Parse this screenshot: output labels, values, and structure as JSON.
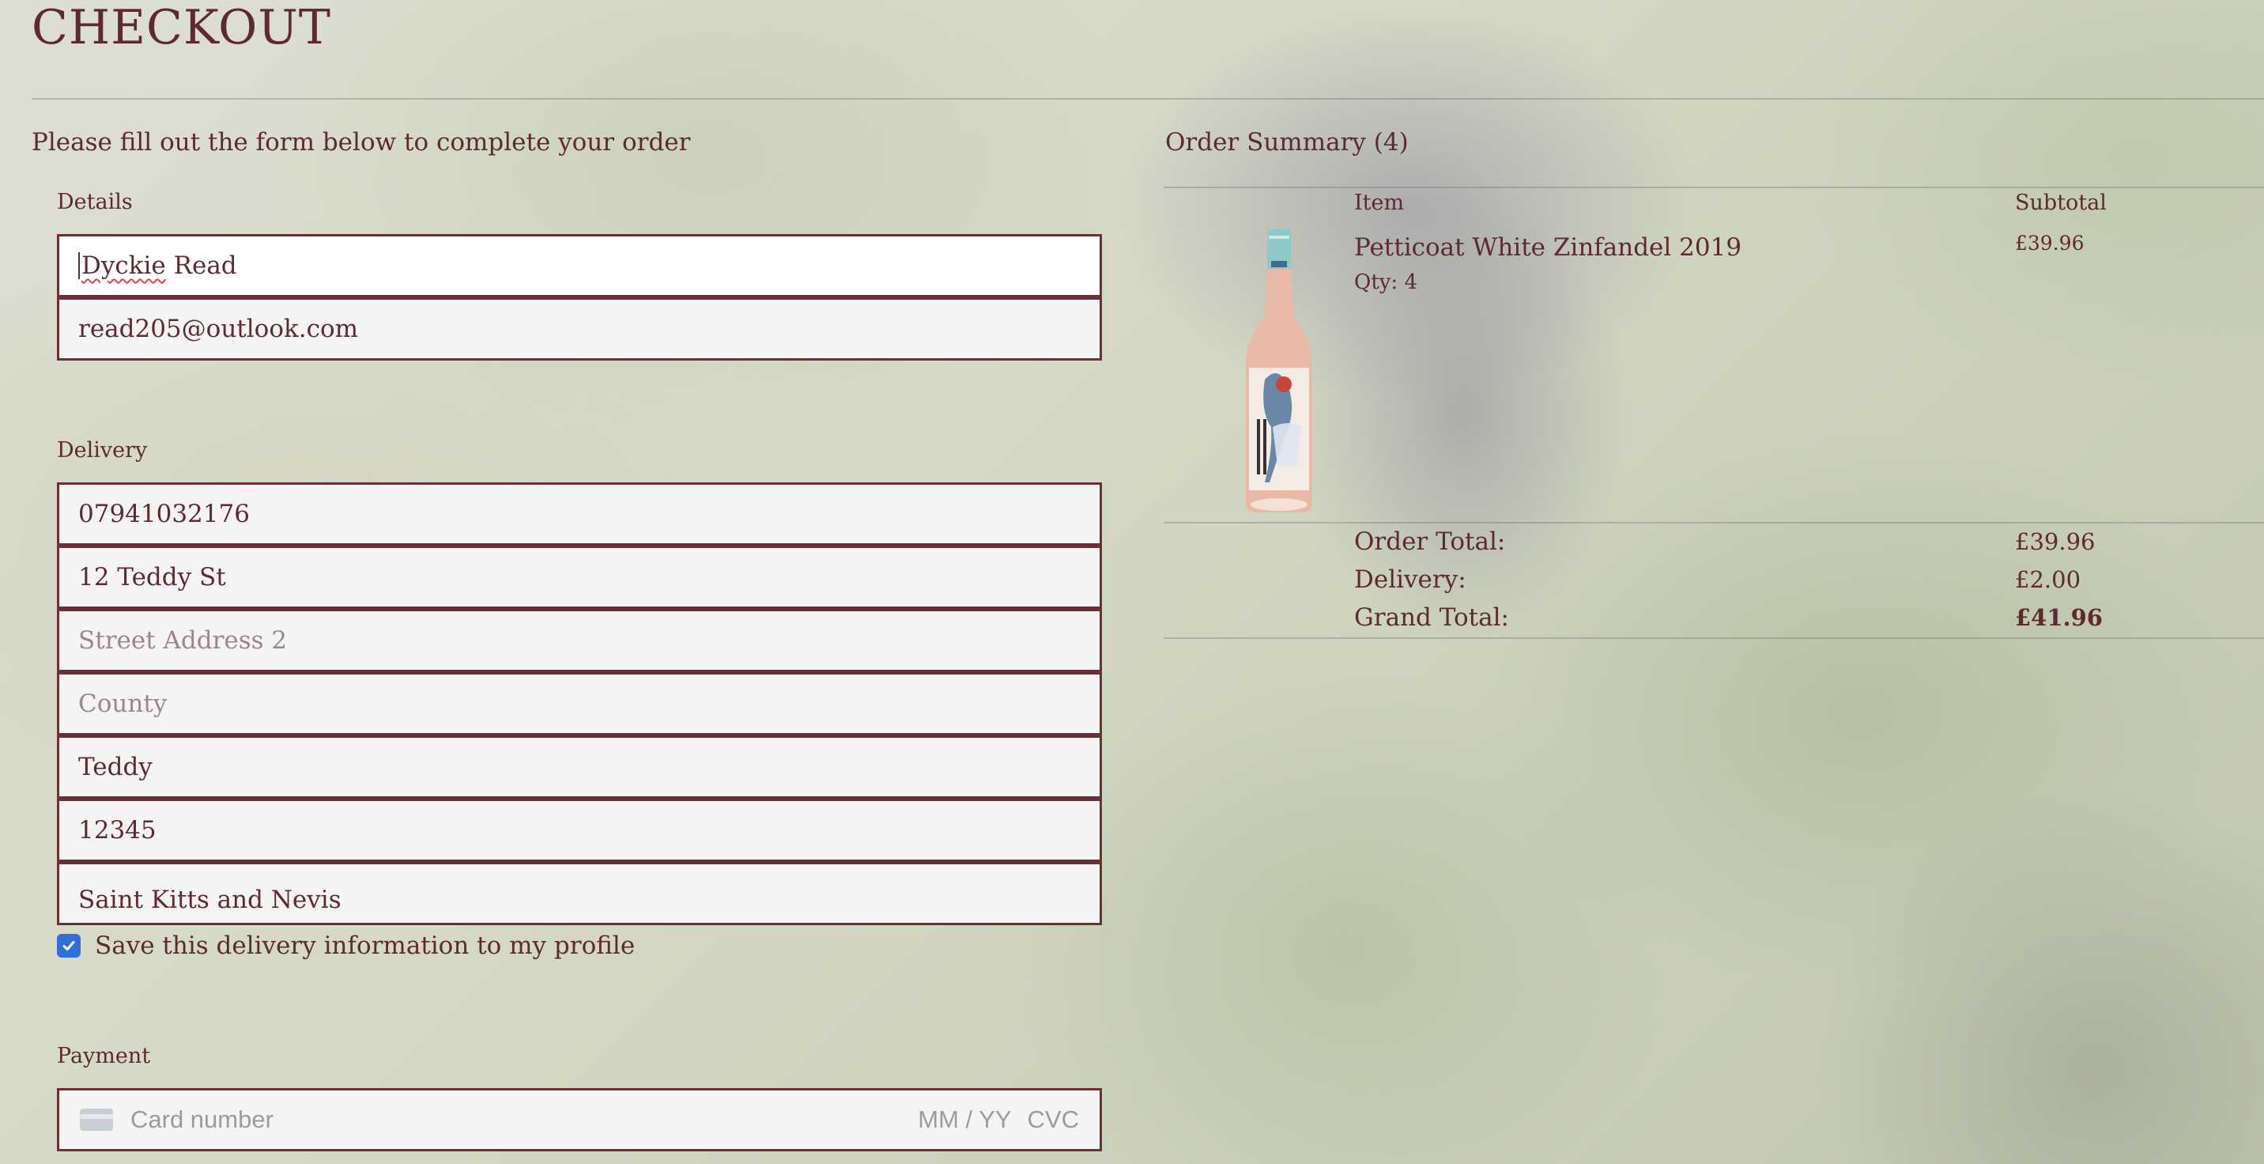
{
  "page": {
    "title": "CHECKOUT",
    "intro": "Please fill out the form below to complete your order"
  },
  "details": {
    "label": "Details",
    "full_name": "Dyckie Read",
    "full_name_first": "Dyckie",
    "full_name_rest": " Read",
    "email": "read205@outlook.com"
  },
  "delivery": {
    "label": "Delivery",
    "phone": "07941032176",
    "street_address_1": "12 Teddy St",
    "street_address_2_placeholder": "Street Address 2",
    "county_placeholder": "County",
    "town": "Teddy",
    "postcode": "12345",
    "country": "Saint Kitts and Nevis",
    "save_info_label": "Save this delivery information to my profile",
    "save_info_checked": true
  },
  "payment": {
    "label": "Payment",
    "card_number_placeholder": "Card number",
    "expiry_placeholder": "MM / YY",
    "cvc_placeholder": "CVC"
  },
  "summary": {
    "title": "Order Summary (4)",
    "item_header": "Item",
    "subtotal_header": "Subtotal",
    "items": [
      {
        "name": "Petticoat White Zinfandel 2019",
        "qty": "Qty: 4",
        "subtotal": "£39.96"
      }
    ],
    "order_total_label": "Order Total:",
    "order_total": "£39.96",
    "delivery_label": "Delivery:",
    "delivery": "£2.00",
    "grand_total_label": "Grand Total:",
    "grand_total": "£41.96"
  },
  "colors": {
    "text": "#5d2a2f",
    "field_border": "#6b3036",
    "checkbox": "#2f6fd6"
  }
}
